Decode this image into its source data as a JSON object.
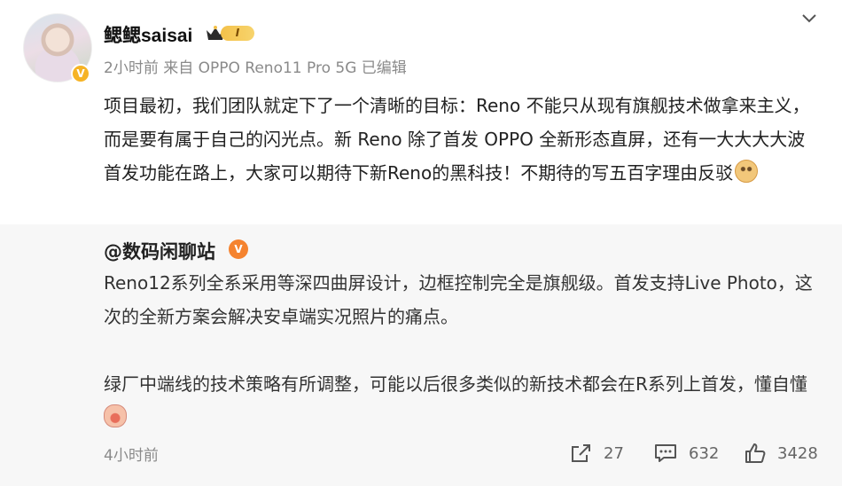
{
  "post": {
    "username": "鳃鳃saisai",
    "level_badge": "I",
    "meta": "2小时前  来自 OPPO Reno11 Pro 5G 已编辑",
    "text": "项目最初，我们团队就定下了一个清晰的目标：Reno 不能只从现有旗舰技术做拿来主义，而是要有属于自己的闪光点。新 Reno 除了首发 OPPO 全新形态直屏，还有一大大大大波首发功能在路上，大家可以期待下新Reno的黑科技！不期待的写五百字理由反驳",
    "verify_badge": "V"
  },
  "repost": {
    "author": "@数码闲聊站",
    "vip_badge": "V",
    "paragraph1": "Reno12系列全系采用等深四曲屏设计，边框控制完全是旗舰级。首发支持Live Photo，这次的全新方案会解决安卓端实况照片的痛点。",
    "paragraph2": "绿厂中端线的技术策略有所调整，可能以后很多类似的新技术都会在R系列上首发，懂自懂",
    "time": "4小时前",
    "share_count": "27",
    "comment_count": "632",
    "like_count": "3428"
  },
  "icons": [
    "chevron-down-icon",
    "share-icon",
    "comment-icon",
    "like-icon",
    "doge-emoji-icon",
    "cat-emoji-icon"
  ],
  "colors": {
    "meta_gray": "#8a8a8a",
    "repost_bg": "#f7f7f7",
    "badge_gold": "#f6b325",
    "vip_orange": "#f5832f"
  }
}
